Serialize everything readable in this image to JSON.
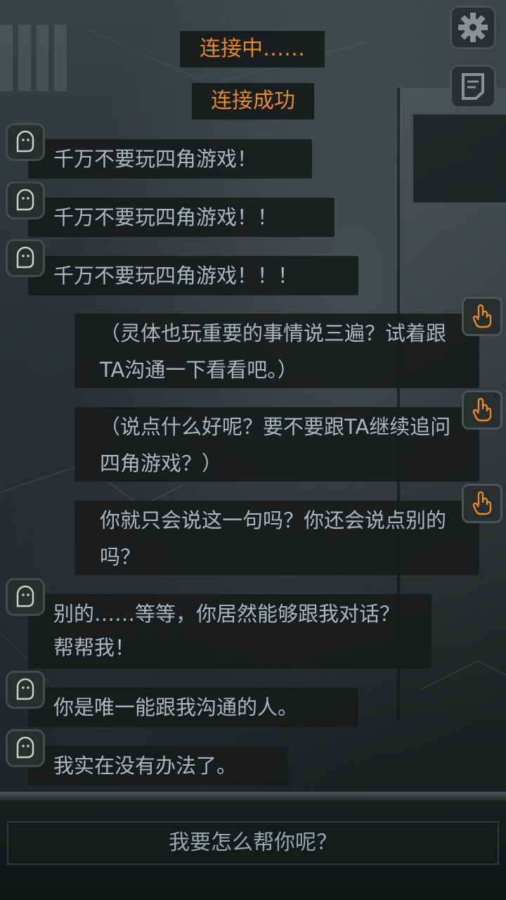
{
  "system_messages": [
    "连接中……",
    "连接成功"
  ],
  "toolbar": {
    "settings_icon": "gear-icon",
    "notes_icon": "notebook-icon"
  },
  "ghost_messages": [
    "千万不要玩四角游戏！",
    "千万不要玩四角游戏！！",
    "千万不要玩四角游戏！！！",
    "别的……等等，你居然能够跟我对话？帮帮我！",
    "你是唯一能跟我沟通的人。",
    "我实在没有办法了。"
  ],
  "player_messages": [
    "（灵体也玩重要的事情说三遍？试着跟TA沟通一下看看吧。）",
    "（说点什么好呢？要不要跟TA继续追问四角游戏？）",
    "你就只会说这一句吗？你还会说点别的吗？"
  ],
  "reply": {
    "label": "我要怎么帮你呢？"
  },
  "colors": {
    "accent": "#e28a2c",
    "text": "#aab7bb",
    "bubble_bg": "#181b1c"
  }
}
